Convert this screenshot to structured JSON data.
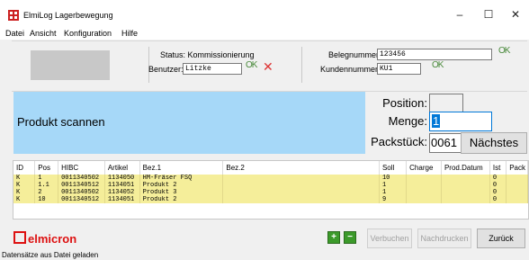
{
  "window": {
    "title": "ElmiLog Lagerbewegung",
    "minimize": "–",
    "maximize": "☐",
    "close": "✕"
  },
  "menu": [
    "Datei",
    "Ansicht",
    "Konfiguration",
    "Hilfe"
  ],
  "header": {
    "status_label": "Status: Kommissionierung",
    "benutzer_label": "Benutzer:",
    "benutzer_value": "Litzke",
    "ok_label": "OK",
    "belegnummer_label": "Belegnummer:",
    "belegnummer_value": "123456",
    "kundennummer_label": "Kundennummer:",
    "kundennummer_value": "KU1"
  },
  "scan": {
    "prompt": "Produkt scannen",
    "position_label": "Position:",
    "position_value": "",
    "menge_label": "Menge:",
    "menge_value": "1",
    "packstueck_label": "Packstück:",
    "packstueck_value": "0061",
    "next_button": "Nächstes"
  },
  "table": {
    "columns": [
      "ID",
      "Pos",
      "HIBC",
      "Artikel",
      "Bez.1",
      "Bez.2",
      "Soll",
      "Charge",
      "Prod.Datum",
      "Ist",
      "Pack"
    ],
    "rows": [
      [
        "K",
        "1",
        "0011340502",
        "1134050",
        "HM-Fräser FSQ",
        "",
        "10",
        "",
        "",
        "0",
        ""
      ],
      [
        "K",
        "1.1",
        "0011340512",
        "1134051",
        "Produkt 2",
        "",
        "1",
        "",
        "",
        "0",
        ""
      ],
      [
        "K",
        "2",
        "0011340502",
        "1134052",
        "Produkt 3",
        "",
        "1",
        "",
        "",
        "0",
        ""
      ],
      [
        "K",
        "10",
        "0011340512",
        "1134051",
        "Produkt 2",
        "",
        "9",
        "",
        "",
        "0",
        ""
      ]
    ]
  },
  "footer": {
    "logo_text": "elmicron",
    "plus": "+",
    "minus": "−",
    "verbuchen": "Verbuchen",
    "nachdrucken": "Nachdrucken",
    "zurueck": "Zurück"
  },
  "statusbar": "Datensätze aus Datei geladen",
  "colors": {
    "scan_bg": "#a6d8f8",
    "row_bg": "#f5ee9a",
    "ok_green": "#4a8a3c",
    "cancel_red": "#d33",
    "brand_red": "#d11"
  }
}
